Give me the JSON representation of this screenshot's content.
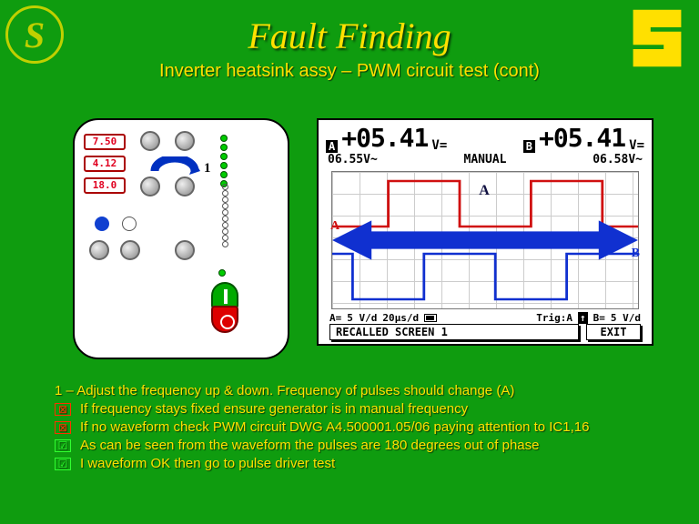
{
  "title": "Fault Finding",
  "subtitle": "Inverter heatsink assy – PWM circuit test (cont)",
  "logo_left_letter": "S",
  "panel": {
    "lcd1": "7.50",
    "lcd2": "4.12",
    "lcd3": "18.0",
    "knob_label": "1"
  },
  "scope": {
    "chA_tag": "A",
    "chA_sign": "+",
    "chA_val": "05.41",
    "chA_unit": "V=",
    "chB_tag": "B",
    "chB_sign": "+",
    "chB_val": "05.41",
    "chB_unit": "V=",
    "sub_left": "06.55V~",
    "sub_mid": "MANUAL",
    "sub_right": "06.58V~",
    "annot_A": "A",
    "label_A": "A",
    "label_B": "B",
    "foot_A": "A=",
    "foot_Av": "5 V/d",
    "foot_time": "20µs/d",
    "foot_trig": "Trig:A",
    "foot_edge": "↑",
    "foot_B": "B=",
    "foot_Bv": "5 V/d",
    "recall": "RECALLED SCREEN 1",
    "exit": "EXIT"
  },
  "notes": {
    "line1": "1 – Adjust the frequency up & down. Frequency of pulses should change (A)",
    "line2": "If frequency stays fixed ensure generator is in manual frequency",
    "line3": "If no waveform check PWM circuit DWG A4.500001.05/06 paying attention to IC1,16",
    "line4": "As can be seen from the waveform the pulses are 180 degrees out of phase",
    "line5": "I waveform OK then go to pulse driver test",
    "mark_x": "⊠",
    "mark_v": "☑"
  }
}
